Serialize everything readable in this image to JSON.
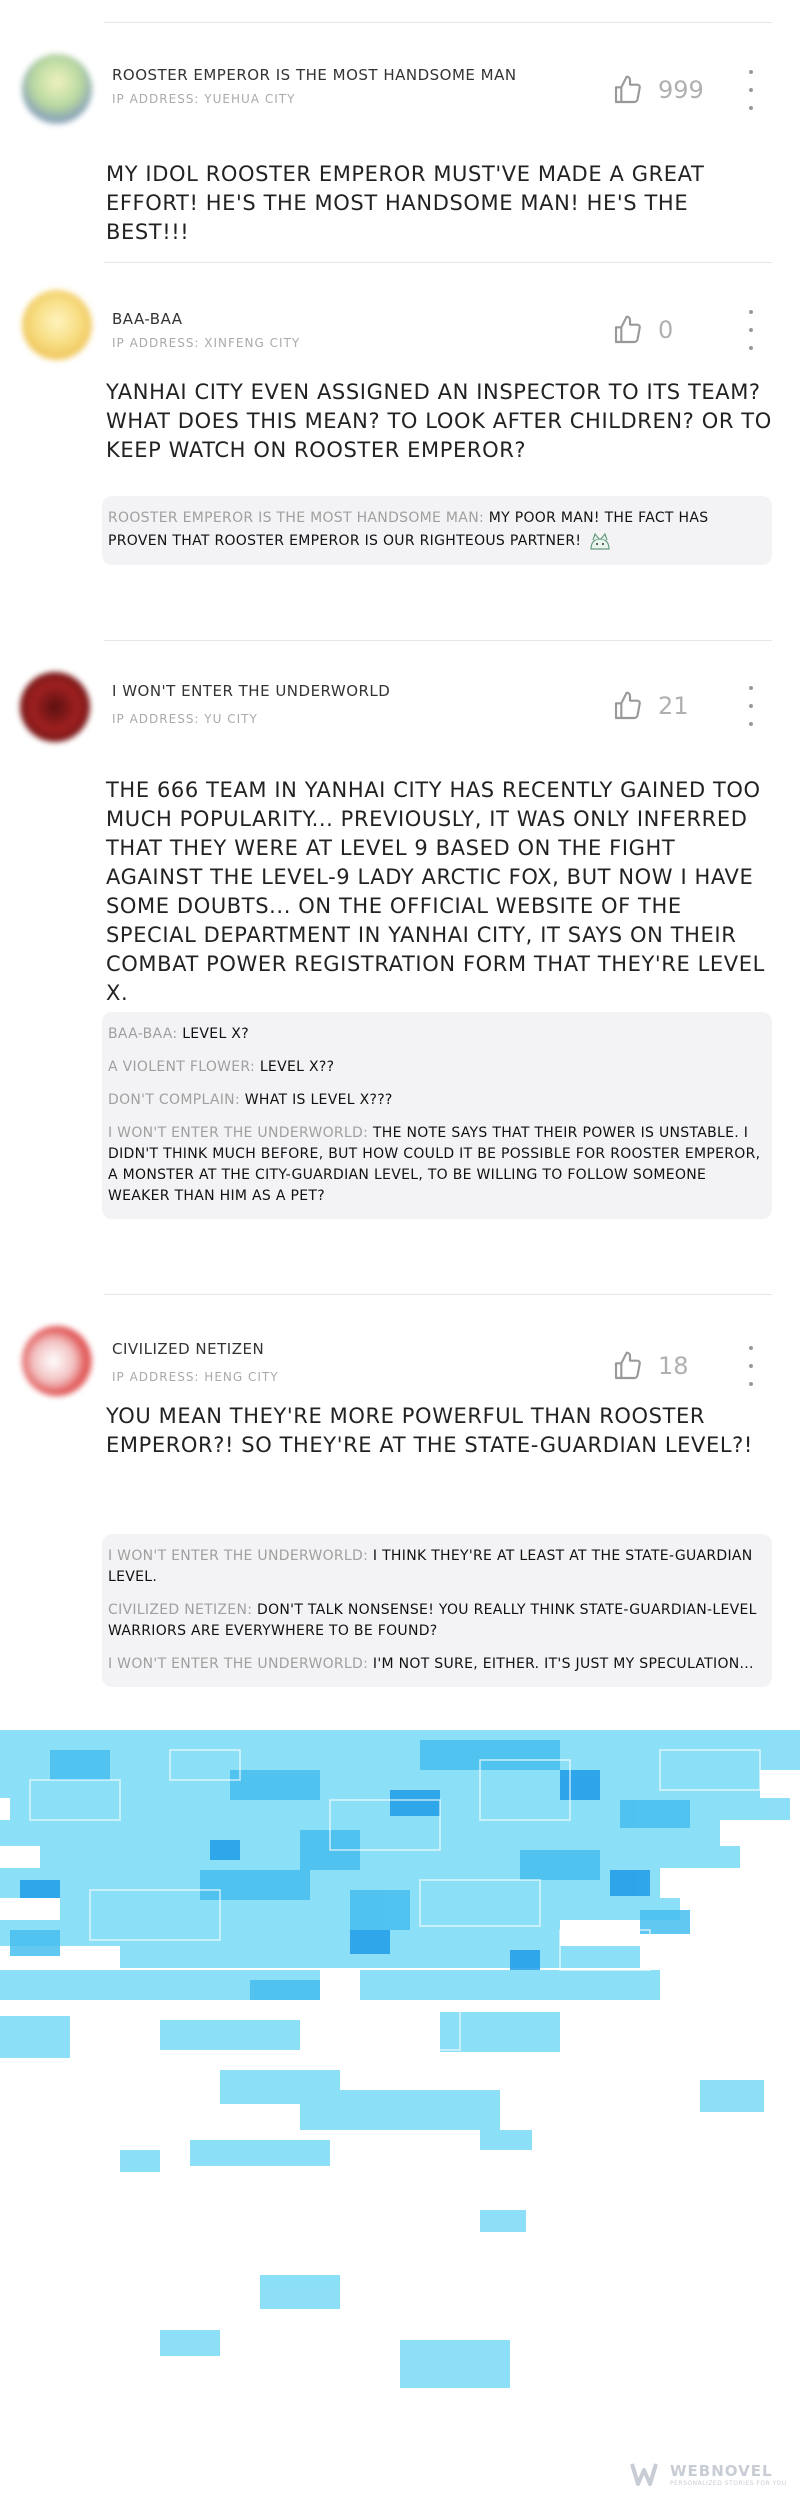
{
  "comments": [
    {
      "username": "ROOSTER EMPEROR IS THE MOST HANDSOME MAN",
      "ip": "IP ADDRESS: YUEHUA CITY",
      "likes": "999",
      "body": "MY IDOL ROOSTER EMPEROR MUST'VE MADE A GREAT EFFORT! HE'S THE MOST HANDSOME MAN! HE'S THE BEST!!!"
    },
    {
      "username": "BAA-BAA",
      "ip": "IP ADDRESS: XINFENG CITY",
      "likes": "0",
      "body": "YANHAI CITY EVEN ASSIGNED AN INSPECTOR TO ITS TEAM? WHAT DOES THIS MEAN? TO LOOK AFTER CHILDREN? OR TO KEEP WATCH ON ROOSTER EMPEROR?",
      "replies": [
        {
          "name": "ROOSTER EMPEROR IS THE MOST HANDSOME MAN:",
          "text": "MY POOR MAN! THE FACT HAS PROVEN THAT ROOSTER EMPEROR IS OUR RIGHTEOUS PARTNER!"
        }
      ]
    },
    {
      "username": "I WON'T ENTER THE UNDERWORLD",
      "ip": "IP ADDRESS: YU CITY",
      "likes": "21",
      "body": "THE 666 TEAM IN YANHAI CITY HAS RECENTLY GAINED TOO MUCH POPULARITY... PREVIOUSLY, IT WAS ONLY INFERRED THAT THEY WERE AT LEVEL 9 BASED ON THE FIGHT AGAINST THE LEVEL-9 LADY ARCTIC FOX, BUT NOW I HAVE SOME DOUBTS... ON THE OFFICIAL WEBSITE OF THE SPECIAL DEPARTMENT IN YANHAI CITY, IT SAYS ON THEIR COMBAT POWER REGISTRATION FORM THAT THEY'RE LEVEL X.",
      "replies": [
        {
          "name": "BAA-BAA:",
          "text": "LEVEL X?"
        },
        {
          "name": "A VIOLENT FLOWER:",
          "text": "LEVEL X??"
        },
        {
          "name": "DON'T COMPLAIN:",
          "text": "WHAT IS LEVEL X???"
        },
        {
          "name": "I WON'T ENTER THE UNDERWORLD:",
          "text": "THE NOTE SAYS THAT THEIR POWER IS UNSTABLE. I DIDN'T THINK MUCH BEFORE, BUT HOW COULD IT BE POSSIBLE FOR ROOSTER EMPEROR, A MONSTER AT THE CITY-GUARDIAN LEVEL, TO BE WILLING TO FOLLOW SOMEONE WEAKER THAN HIM AS A PET?"
        }
      ]
    },
    {
      "username": "CIVILIZED NETIZEN",
      "ip": "IP ADDRESS: HENG CITY",
      "likes": "18",
      "body": "YOU MEAN THEY'RE MORE POWERFUL THAN ROOSTER EMPEROR?! SO THEY'RE AT THE STATE-GUARDIAN LEVEL?!",
      "replies": [
        {
          "name": "I WON'T ENTER THE UNDERWORLD:",
          "text": "I THINK THEY'RE AT LEAST AT THE STATE-GUARDIAN LEVEL."
        },
        {
          "name": "CIVILIZED NETIZEN:",
          "text": "DON'T TALK NONSENSE! YOU REALLY THINK STATE-GUARDIAN-LEVEL WARRIORS ARE EVERYWHERE TO BE FOUND?"
        },
        {
          "name": "I WON'T ENTER THE UNDERWORLD:",
          "text": "I'M NOT SURE, EITHER. IT'S JUST MY SPECULATION..."
        }
      ]
    }
  ],
  "icons": {
    "like": "thumbs-up-icon",
    "more": "more-vertical-icon",
    "emoji": "cat-emoji-icon",
    "logo": "webnovel-logo-icon"
  },
  "colors": {
    "mosaic": "#5fd3f3",
    "mosaic_dark": "#2aa8ec",
    "reply_bg": "#f3f3f5",
    "muted": "#a0a0a0"
  },
  "footer": {
    "brand": "WEBNOVEL",
    "tagline": "PERSONALIZED STORIES FOR YOU"
  }
}
